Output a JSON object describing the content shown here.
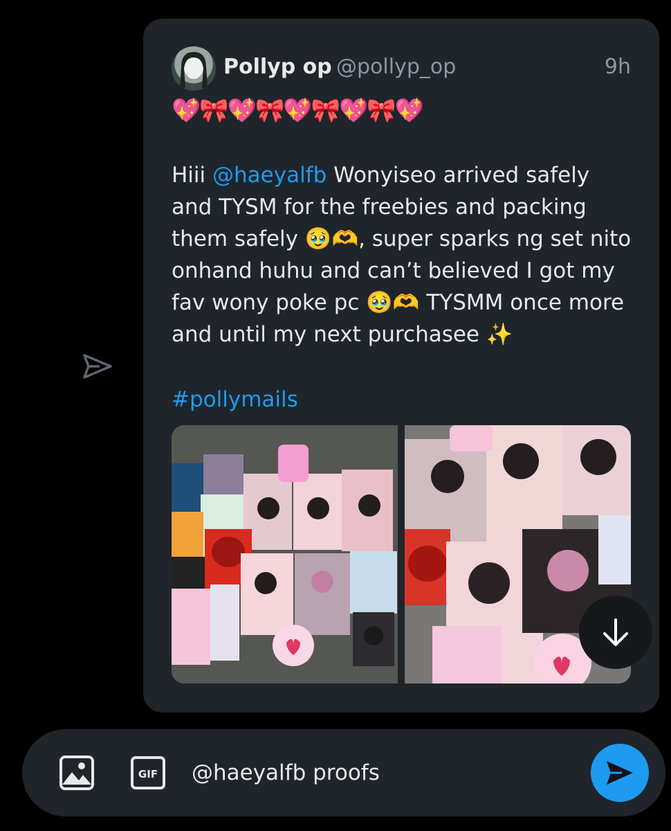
{
  "tweet": {
    "display_name": "Pollyp op",
    "handle": "@pollyp_op",
    "time": "9h",
    "emoji_line": "💖🎀💖🎀💖🎀💖🎀💖",
    "body_pre": "Hiii ",
    "mention": "@haeyalfb",
    "body_post": " Wonyiseo arrived safely and TYSM for the freebies and packing them safely 🥹🫶, super sparks ng set nito onhand huhu and can’t believed I got my fav wony poke pc 🥹🫶 TYSMM once more and until my next purchasee ✨",
    "hashtag": "#pollymails"
  },
  "icons": {
    "side_send": "send-outline-icon",
    "scroll_down": "arrow-down-icon",
    "image": "image-icon",
    "gif": "gif-icon",
    "send": "send-icon"
  },
  "composer": {
    "gif_label": "GIF",
    "text": "@haeyalfb proofs"
  },
  "colors": {
    "background": "#000000",
    "card": "#1f252b",
    "link": "#1d9bf0",
    "text": "#e7e9ea",
    "secondary": "#8b98a5"
  }
}
